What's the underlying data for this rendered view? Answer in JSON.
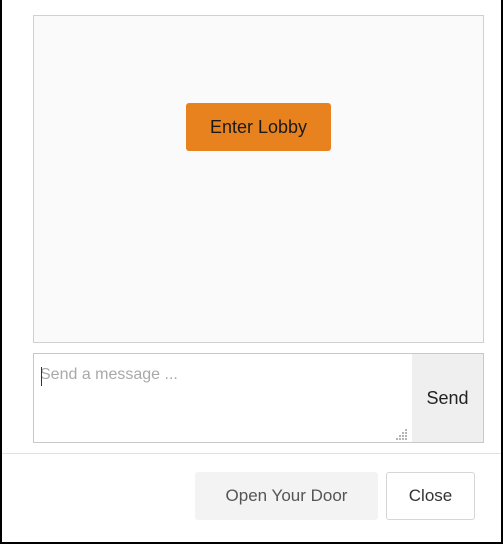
{
  "lobby": {
    "enter_button_label": "Enter Lobby",
    "accent_color": "#e8821f"
  },
  "chat": {
    "message_placeholder": "Send a message ...",
    "message_value": "",
    "send_label": "Send",
    "resize_icon": "resize-grip-icon"
  },
  "footer": {
    "open_door_label": "Open Your Door",
    "close_label": "Close"
  }
}
